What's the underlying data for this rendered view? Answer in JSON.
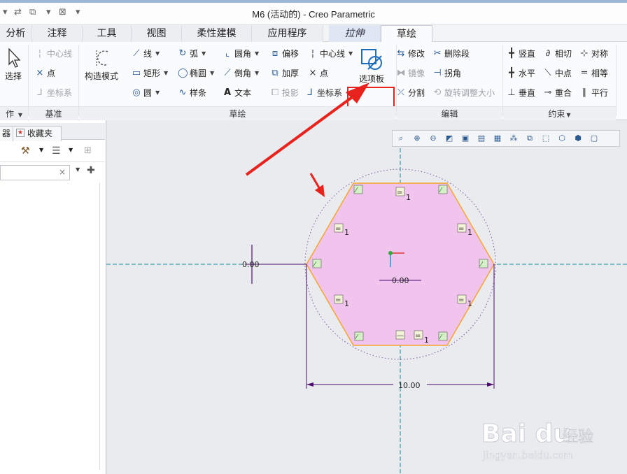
{
  "window": {
    "title": "M6 (活动的) - Creo Parametric"
  },
  "tabs": [
    {
      "label": "分析"
    },
    {
      "label": "注释"
    },
    {
      "label": "工具"
    },
    {
      "label": "视图"
    },
    {
      "label": "柔性建模"
    },
    {
      "label": "应用程序"
    },
    {
      "label": "拉伸"
    },
    {
      "label": "草绘"
    }
  ],
  "ribbon": {
    "operations": {
      "select": "选择",
      "group": "作"
    },
    "datum": {
      "centerline": "中心线",
      "point": "点",
      "coord": "坐标系",
      "group": "基准"
    },
    "sketch": {
      "construct_mode": "构造模式",
      "line": "线",
      "arc": "弧",
      "fillet": "圆角",
      "offset": "偏移",
      "centerline": "中心线",
      "rectangle": "矩形",
      "ellipse": "椭圆",
      "chamfer": "倒角",
      "thicken": "加厚",
      "point": "点",
      "circle": "圆",
      "spline": "样条",
      "text": "文本",
      "project": "投影",
      "coord": "坐标系",
      "palette": "选项板",
      "group": "草绘"
    },
    "edit": {
      "modify": "修改",
      "delete_seg": "删除段",
      "mirror": "镜像",
      "corner": "拐角",
      "divide": "分割",
      "rotate_resize": "旋转调整大小",
      "group": "编辑"
    },
    "constrain": {
      "vertical": "竖直",
      "tangent": "相切",
      "symmetric": "对称",
      "horizontal": "水平",
      "midpoint": "中点",
      "equal": "相等",
      "perpendicular": "垂直",
      "coincident": "重合",
      "parallel": "平行",
      "group": "约束"
    }
  },
  "left_panel": {
    "tab_cut": "器",
    "tab_favorites": "收藏夹"
  },
  "sketch": {
    "dim_width": "10.00",
    "origin_label": "0.00",
    "vert_label": "0.00",
    "eq_index": "1"
  },
  "watermark": {
    "brand": "Bai du",
    "brand_cn": "经验",
    "url": "jingyan.baidu.com"
  },
  "colors": {
    "accent": "#2c5d99",
    "highlight": "#e8231e",
    "hex_fill": "#f0c4ec",
    "hex_stroke": "#f5a630",
    "centerline": "#178a9e",
    "dim": "#4b0e6b"
  }
}
